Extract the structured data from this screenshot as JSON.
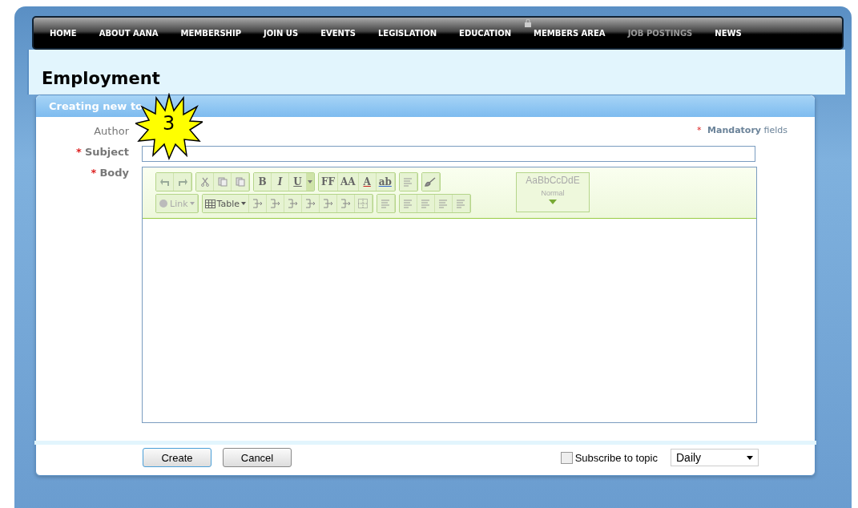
{
  "nav": [
    {
      "label": "HOME",
      "selected": false
    },
    {
      "label": "ABOUT AANA",
      "selected": false
    },
    {
      "label": "MEMBERSHIP",
      "selected": false
    },
    {
      "label": "JOIN US",
      "selected": false
    },
    {
      "label": "EVENTS",
      "selected": false
    },
    {
      "label": "LEGISLATION",
      "selected": false
    },
    {
      "label": "EDUCATION",
      "selected": false
    },
    {
      "label": "MEMBERS AREA",
      "selected": false,
      "locked": true
    },
    {
      "label": "JOB POSTINGS",
      "selected": true
    },
    {
      "label": "NEWS",
      "selected": false
    }
  ],
  "page_title": "Employment",
  "panel": {
    "title": "Creating new to",
    "callout": "3",
    "mandatory_mark": "*",
    "mandatory_note": "**Mandatory** fields",
    "fields": [
      {
        "label": "Author",
        "kind": "text"
      },
      {
        "label": "Subject",
        "marker": "*",
        "kind": "input"
      },
      {
        "label": "Body",
        "marker": "*",
        "kind": "editor"
      }
    ],
    "toolbar_rows": [
      [
        [
          {
            "kind": "undo"
          },
          {
            "kind": "redo"
          }
        ],
        [
          {
            "kind": "cut"
          },
          {
            "kind": "copy"
          },
          {
            "kind": "paste"
          }
        ],
        [
          {
            "kind": "bold",
            "label": "B"
          },
          {
            "kind": "italic",
            "label": "I"
          },
          {
            "kind": "underline",
            "label": "U"
          },
          {
            "kind": "more"
          }
        ],
        [
          {
            "kind": "font-family",
            "label": "FF"
          },
          {
            "kind": "font-size",
            "label": "AA"
          },
          {
            "kind": "font-color",
            "label": "A"
          },
          {
            "kind": "highlight",
            "label": "ab"
          }
        ],
        [
          {
            "kind": "align"
          }
        ],
        [
          {
            "kind": "clean"
          }
        ]
      ],
      [
        [
          {
            "kind": "link",
            "label": "Link"
          }
        ],
        [
          {
            "kind": "table",
            "label": "Table"
          },
          {
            "kind": "insert"
          },
          {
            "kind": "insert"
          },
          {
            "kind": "insert"
          },
          {
            "kind": "insert"
          },
          {
            "kind": "insert"
          },
          {
            "kind": "insert"
          },
          {
            "kind": "grid"
          }
        ],
        [
          {
            "kind": "paragraph"
          }
        ],
        [
          {
            "kind": "list"
          },
          {
            "kind": "list"
          },
          {
            "kind": "indent"
          },
          {
            "kind": "indent"
          }
        ]
      ]
    ],
    "style_preview": "AaBbCcDdE",
    "style_name": "Normal",
    "buttons": [
      "Create",
      "Cancel"
    ],
    "subscribe": {
      "label": "Subscribe to topic",
      "checked": false
    },
    "frequency": "Daily"
  }
}
